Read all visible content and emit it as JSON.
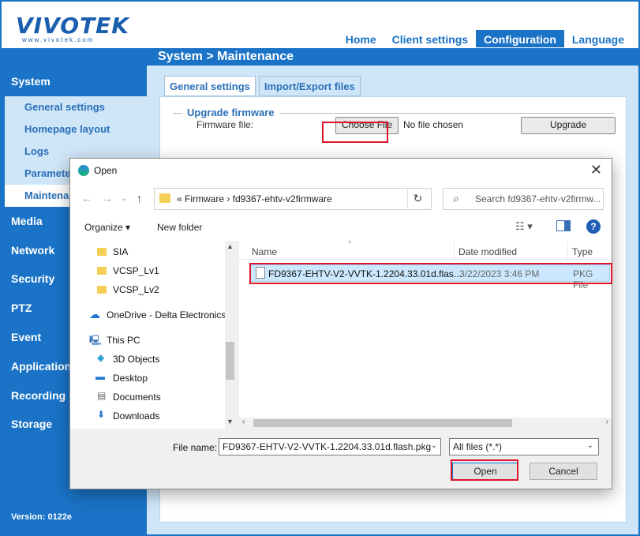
{
  "app": {
    "brand": "VIVOTEK",
    "brand_url": "www.vivotek.com",
    "top_nav": [
      "Home",
      "Client settings",
      "Configuration",
      "Language"
    ],
    "active_nav": "Configuration",
    "page_title": "System  > Maintenance"
  },
  "sidebar": {
    "sections": [
      "System",
      "Media",
      "Network",
      "Security",
      "PTZ",
      "Event",
      "Applications",
      "Recording",
      "Storage"
    ],
    "system_items": [
      "General settings",
      "Homepage layout",
      "Logs",
      "Parameters",
      "Maintenance"
    ],
    "active_item": "Maintenance",
    "version": "Version: 0122e"
  },
  "main": {
    "tabs": [
      "General settings",
      "Import/Export files"
    ],
    "active_tab": "General settings",
    "upgrade_legend": "Upgrade firmware",
    "firmware_label": "Firmware file:",
    "choose_file_label": "Choose File",
    "no_file_text": "No file chosen",
    "upgrade_label": "Upgrade"
  },
  "dialog": {
    "title": "Open",
    "address_crumbs": "«   Firmware   ›   fd9367-ehtv-v2firmware",
    "search_placeholder": "Search fd9367-ehtv-v2firmw...",
    "organize_label": "Organize ▾",
    "new_folder_label": "New folder",
    "nav_items": [
      {
        "label": "SIA",
        "icon": "folder-icon"
      },
      {
        "label": "VCSP_Lv1",
        "icon": "folder-icon"
      },
      {
        "label": "VCSP_Lv2",
        "icon": "folder-icon"
      },
      {
        "label": "OneDrive - Delta Electronics,",
        "icon": "cloud-icon"
      },
      {
        "label": "This PC",
        "icon": "computer-icon"
      },
      {
        "label": "3D Objects",
        "icon": "cube-icon"
      },
      {
        "label": "Desktop",
        "icon": "desktop-icon"
      },
      {
        "label": "Documents",
        "icon": "document-icon"
      },
      {
        "label": "Downloads",
        "icon": "download-icon"
      }
    ],
    "columns": [
      "Name",
      "Date modified",
      "Type"
    ],
    "files": [
      {
        "name": "FD9367-EHTV-V2-VVTK-1.2204.33.01d.flas...",
        "date": "3/22/2023 3:46 PM",
        "type": "PKG File"
      }
    ],
    "file_name_label": "File name:",
    "file_name_value": "FD9367-EHTV-V2-VVTK-1.2204.33.01d.flash.pkg",
    "file_type_value": "All files (*.*)",
    "open_label": "Open",
    "cancel_label": "Cancel"
  },
  "colors": {
    "brand_blue": "#1a73c7",
    "highlight_red": "#e0152a",
    "selection": "#cce8ff"
  }
}
